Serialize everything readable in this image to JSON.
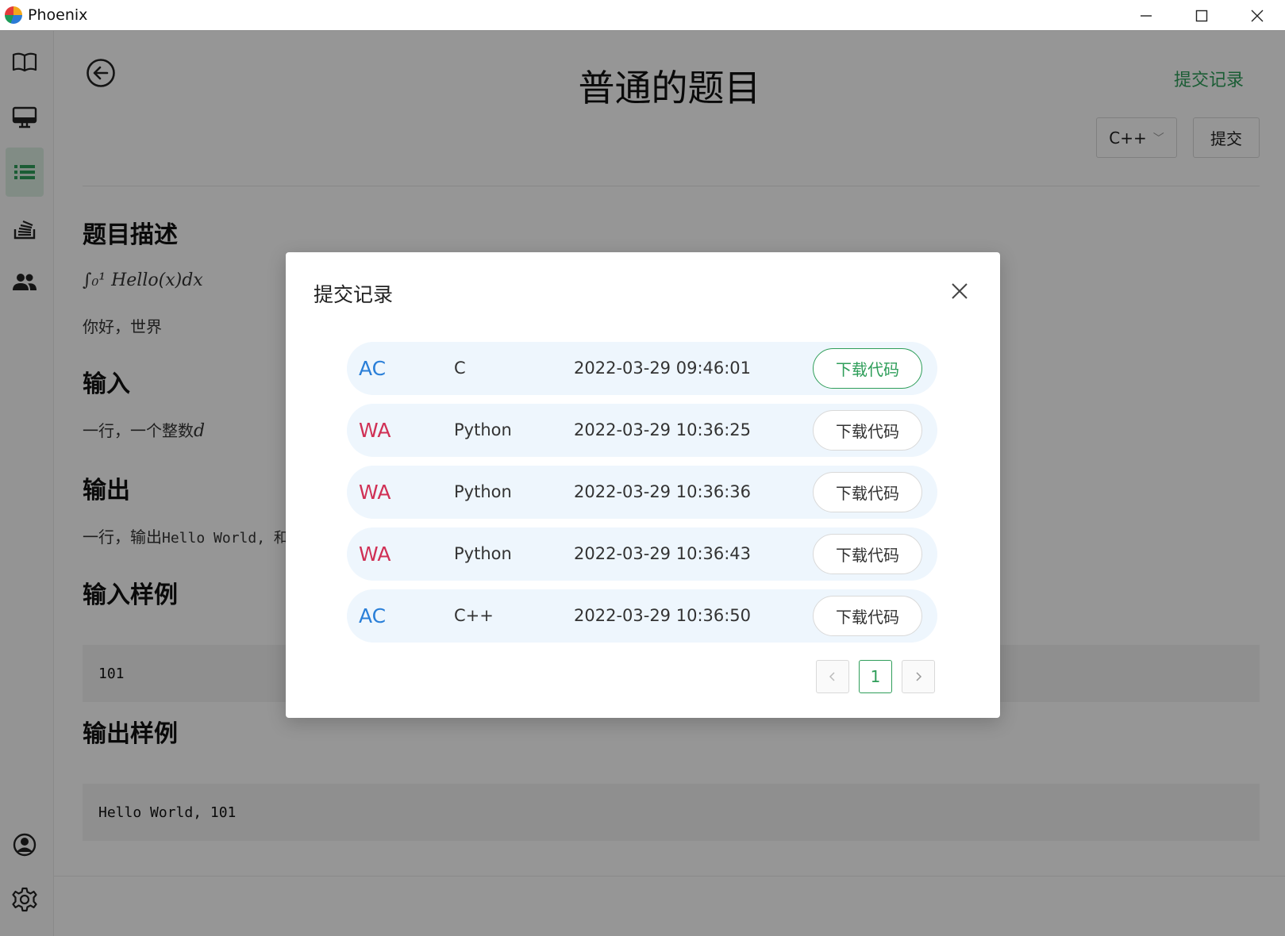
{
  "window": {
    "title": "Phoenix"
  },
  "page": {
    "title": "普通的题目",
    "records_link": "提交记录",
    "language_selected": "C++",
    "submit_label": "提交"
  },
  "problem": {
    "desc_heading": "题目描述",
    "formula": "∫₀¹ Hello(x)dx",
    "desc_text": "你好，世界",
    "input_heading": "输入",
    "input_text_prefix": "一行，一个整数",
    "input_var": "d",
    "output_heading": "输出",
    "output_text_prefix": "一行，输出",
    "output_code": "Hello World, 和",
    "sample_input_heading": "输入样例",
    "sample_input": "101",
    "sample_output_heading": "输出样例",
    "sample_output": "Hello World, 101"
  },
  "modal": {
    "title": "提交记录",
    "download_label": "下载代码",
    "records": [
      {
        "status": "AC",
        "language": "C",
        "time": "2022-03-29 09:46:01"
      },
      {
        "status": "WA",
        "language": "Python",
        "time": "2022-03-29 10:36:25"
      },
      {
        "status": "WA",
        "language": "Python",
        "time": "2022-03-29 10:36:36"
      },
      {
        "status": "WA",
        "language": "Python",
        "time": "2022-03-29 10:36:43"
      },
      {
        "status": "AC",
        "language": "C++",
        "time": "2022-03-29 10:36:50"
      }
    ],
    "pagination": {
      "current_page": "1"
    }
  },
  "colors": {
    "accent_green": "#2f9e5a",
    "ac_blue": "#2a7fd8",
    "wa_red": "#d03055",
    "row_bg": "#eef6fd"
  },
  "icons": {
    "sidebar": [
      "book-icon",
      "monitor-icon",
      "list-icon",
      "stack-icon",
      "users-icon",
      "user-circle-icon",
      "gear-icon"
    ],
    "back": "arrow-left-circle-icon",
    "close": "close-icon"
  }
}
